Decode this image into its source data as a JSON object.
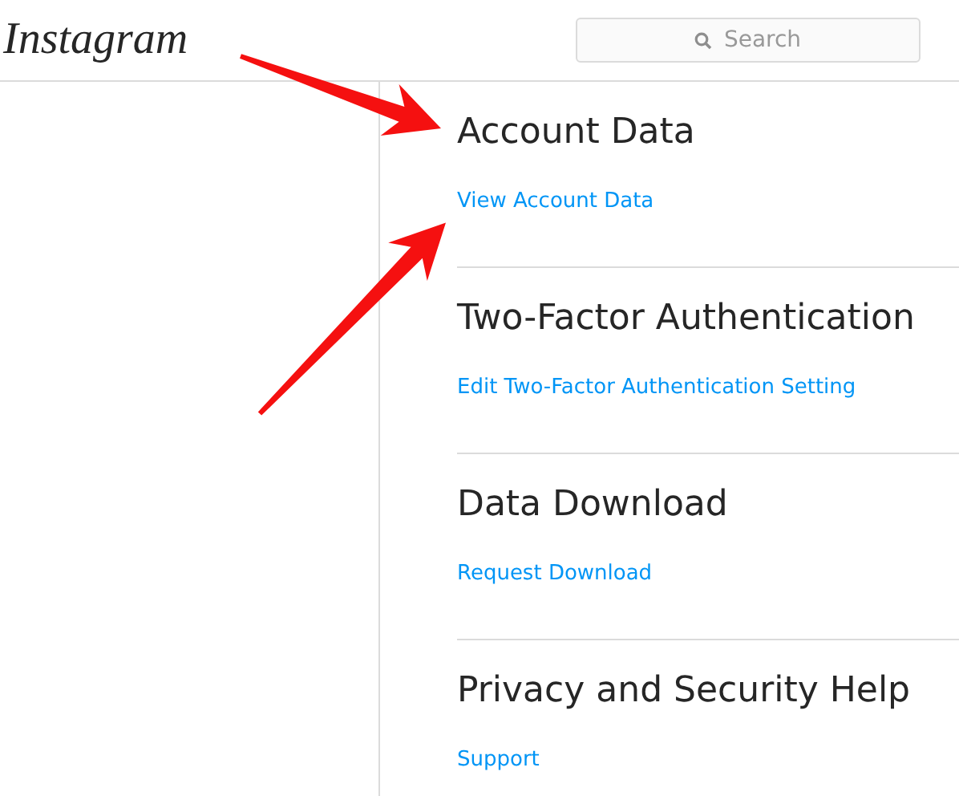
{
  "header": {
    "logo": "Instagram",
    "search": {
      "placeholder": "Search"
    }
  },
  "sections": [
    {
      "title": "Account Data",
      "link": "View Account Data"
    },
    {
      "title": "Two-Factor Authentication",
      "link": "Edit Two-Factor Authentication Setting"
    },
    {
      "title": "Data Download",
      "link": "Request Download"
    },
    {
      "title": "Privacy and Security Help",
      "link": "Support"
    }
  ],
  "annotation_arrows": true
}
